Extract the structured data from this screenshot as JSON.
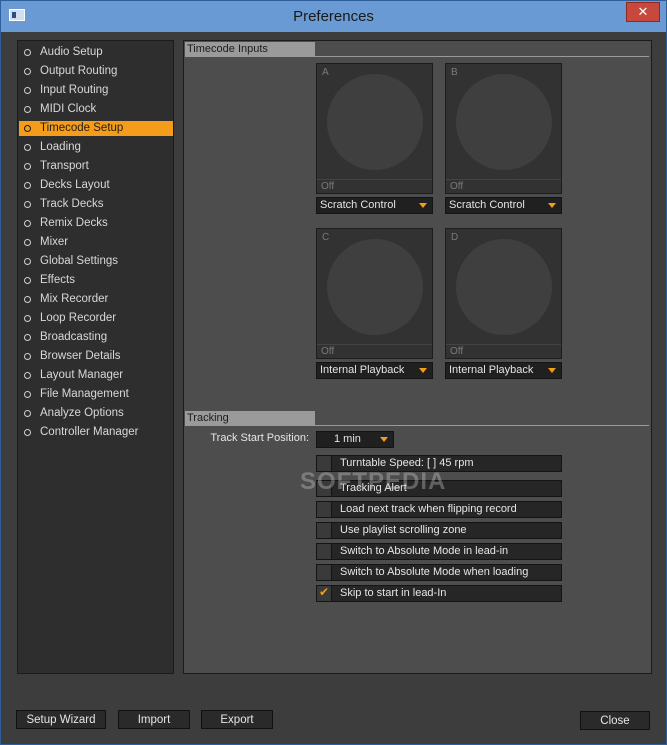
{
  "window": {
    "title": "Preferences",
    "close_symbol": "✕"
  },
  "sidebar": {
    "items": [
      {
        "label": "Audio Setup"
      },
      {
        "label": "Output Routing"
      },
      {
        "label": "Input Routing"
      },
      {
        "label": "MIDI Clock"
      },
      {
        "label": "Timecode Setup",
        "active": true
      },
      {
        "label": "Loading"
      },
      {
        "label": "Transport"
      },
      {
        "label": "Decks Layout"
      },
      {
        "label": "Track Decks"
      },
      {
        "label": "Remix Decks"
      },
      {
        "label": "Mixer"
      },
      {
        "label": "Global Settings"
      },
      {
        "label": "Effects"
      },
      {
        "label": "Mix Recorder"
      },
      {
        "label": "Loop Recorder"
      },
      {
        "label": "Broadcasting"
      },
      {
        "label": "Browser Details"
      },
      {
        "label": "Layout Manager"
      },
      {
        "label": "File Management"
      },
      {
        "label": "Analyze Options"
      },
      {
        "label": "Controller Manager"
      }
    ]
  },
  "timecode_inputs": {
    "header": "Timecode Inputs",
    "decks": [
      {
        "letter": "A",
        "status": "Off",
        "mode": "Scratch Control"
      },
      {
        "letter": "B",
        "status": "Off",
        "mode": "Scratch Control"
      },
      {
        "letter": "C",
        "status": "Off",
        "mode": "Internal Playback"
      },
      {
        "letter": "D",
        "status": "Off",
        "mode": "Internal Playback"
      }
    ]
  },
  "tracking": {
    "header": "Tracking",
    "track_start_label": "Track Start Position:",
    "track_start_value": "1 min",
    "options": [
      {
        "label": "Turntable Speed: [ ] 45 rpm",
        "checked": false
      },
      {
        "label": "Tracking Alert",
        "checked": false
      },
      {
        "label": "Load next track when flipping record",
        "checked": false
      },
      {
        "label": "Use playlist scrolling zone",
        "checked": false
      },
      {
        "label": "Switch to Absolute Mode in lead-in",
        "checked": false
      },
      {
        "label": "Switch to Absolute Mode when loading",
        "checked": false
      },
      {
        "label": "Skip to start in lead-In",
        "checked": true
      }
    ]
  },
  "watermark": "SOFTPEDIA",
  "footer": {
    "setup_wizard": "Setup Wizard",
    "import": "Import",
    "export": "Export",
    "close": "Close"
  },
  "colors": {
    "accent": "#f59c1a",
    "panel": "#4d4d4d",
    "sidebar": "#2e2e2e",
    "titlebar": "#6a9ad4"
  }
}
